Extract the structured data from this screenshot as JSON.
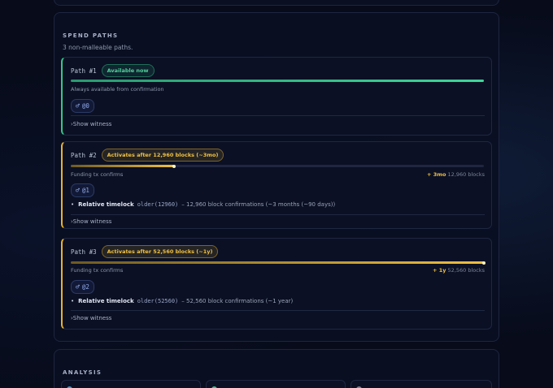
{
  "spend_paths": {
    "title": "SPEND PATHS",
    "subtitle": "3 non-malleable paths.",
    "paths": [
      {
        "label": "Path #1",
        "badge": "Available now",
        "progress": 1.0,
        "note_left": "Always available from confirmation",
        "key": "@0",
        "show_witness": "›Show witness",
        "color": "#34c78a"
      },
      {
        "label": "Path #2",
        "badge": "Activates after 12,960 blocks (~3mo)",
        "progress": 0.25,
        "note_left": "Funding tx confirms",
        "delay_highlight": "+ 3mo",
        "delay_blocks": "12,960 blocks",
        "key": "@1",
        "timelock_name": "Relative timelock",
        "timelock_code": "older(12960)",
        "timelock_desc": "– 12,960 block confirmations (~3 months (~90 days))",
        "show_witness": "›Show witness",
        "color": "#e7b42f"
      },
      {
        "label": "Path #3",
        "badge": "Activates after 52,560 blocks (~1y)",
        "progress": 1.0,
        "note_left": "Funding tx confirms",
        "delay_highlight": "+ 1y",
        "delay_blocks": "52,560 blocks",
        "key": "@2",
        "timelock_name": "Relative timelock",
        "timelock_code": "older(52560)",
        "timelock_desc": "– 52,560 block confirmations (~1 year)",
        "show_witness": "›Show witness",
        "color": "#e7b42f"
      }
    ]
  },
  "analysis": {
    "title": "ANALYSIS",
    "cards": [
      {
        "icon_color": "#3aa0d8"
      },
      {
        "icon_color": "#34c78a"
      },
      {
        "icon_color": "#7c859a"
      }
    ]
  },
  "icons": {
    "key": "key-icon"
  }
}
